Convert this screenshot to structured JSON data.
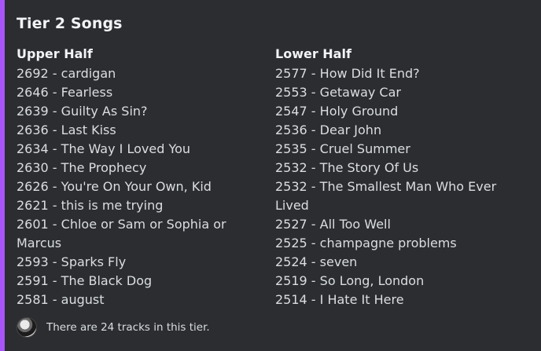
{
  "title": "Tier 2 Songs",
  "upper": {
    "header": "Upper Half",
    "items": [
      "2692 - cardigan",
      "2646 - Fearless",
      "2639 - Guilty As Sin?",
      "2636 - Last Kiss",
      "2634 - The Way I Loved You",
      "2630 - The Prophecy",
      "2626 - You're On Your Own, Kid",
      "2621 - this is me trying",
      "2601 - Chloe or Sam or Sophia or Marcus",
      "2593 - Sparks Fly",
      "2591 - The Black Dog",
      "2581 - august"
    ]
  },
  "lower": {
    "header": "Lower Half",
    "items": [
      "2577 - How Did It End?",
      "2553 - Getaway Car",
      "2547 - Holy Ground",
      "2536 - Dear John",
      "2535 - Cruel Summer",
      "2532 - The Story Of Us",
      "2532 - The Smallest Man Who Ever Lived",
      "2527 - All Too Well",
      "2525 - champagne problems",
      "2524 - seven",
      "2519 - So Long, London",
      "2514 - I Hate It Here"
    ]
  },
  "footer": {
    "text": "There are 24 tracks in this tier."
  },
  "colors": {
    "accent": "#a855f7",
    "background": "#2b2d31"
  }
}
